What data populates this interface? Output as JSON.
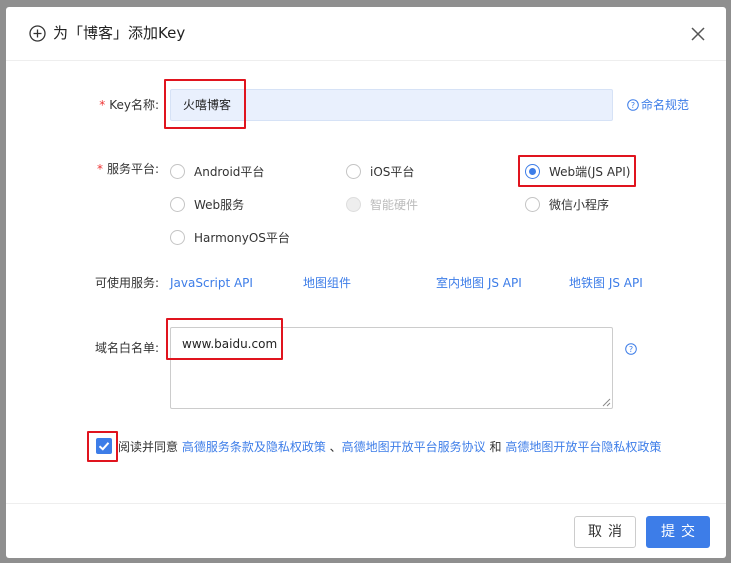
{
  "dialog": {
    "title": "为「博客」添加Key",
    "close_glyph": "×"
  },
  "form": {
    "key_name": {
      "required_mark": "*",
      "label": "Key名称:",
      "value": "火嘻博客",
      "help_link": "命名规范"
    },
    "platform": {
      "required_mark": "*",
      "label": "服务平台:",
      "options": [
        {
          "label": "Android平台",
          "checked": false,
          "disabled": false
        },
        {
          "label": "iOS平台",
          "checked": false,
          "disabled": false
        },
        {
          "label": "Web端(JS API)",
          "checked": true,
          "disabled": false
        },
        {
          "label": "Web服务",
          "checked": false,
          "disabled": false
        },
        {
          "label": "智能硬件",
          "checked": false,
          "disabled": true
        },
        {
          "label": "微信小程序",
          "checked": false,
          "disabled": false
        },
        {
          "label": "HarmonyOS平台",
          "checked": false,
          "disabled": false
        }
      ]
    },
    "services": {
      "label": "可使用服务:",
      "links": [
        "JavaScript API",
        "地图组件",
        "室内地图 JS API",
        "地铁图 JS API"
      ]
    },
    "domain_whitelist": {
      "label": "域名白名单:",
      "value": "www.baidu.com"
    },
    "agreement": {
      "checked": true,
      "prefix": "阅读并同意 ",
      "link1": "高德服务条款及隐私权政策",
      "sep1": " 、",
      "link2": "高德地图开放平台服务协议",
      "sep2": " 和 ",
      "link3": "高德地图开放平台隐私权政策"
    }
  },
  "footer": {
    "cancel_label": "取消",
    "submit_label": "提交"
  },
  "colors": {
    "accent": "#3d7de8",
    "highlight_box": "#e0141e",
    "required": "#e33",
    "input_fill": "#e9f0fd"
  }
}
